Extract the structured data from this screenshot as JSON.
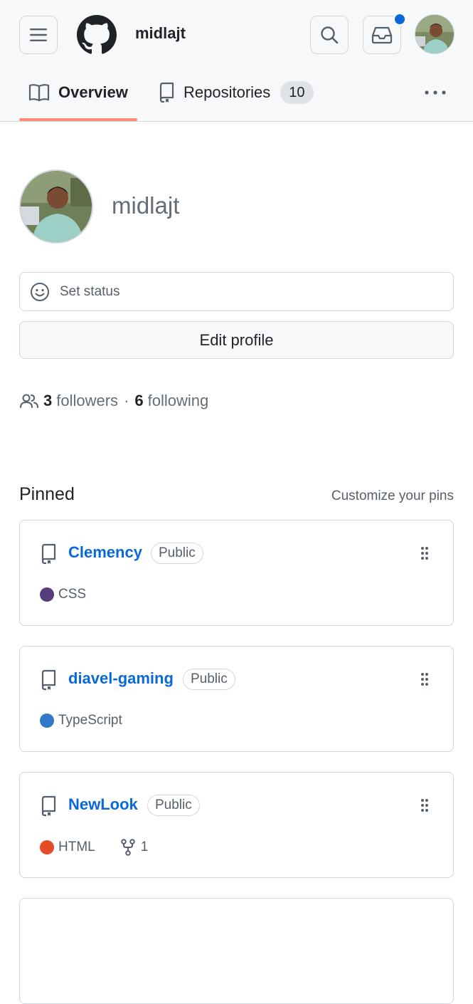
{
  "header": {
    "username": "midlajt"
  },
  "tabs": [
    {
      "label": "Overview",
      "icon": "book-icon"
    },
    {
      "label": "Repositories",
      "icon": "repo-icon",
      "count": "10"
    }
  ],
  "profile": {
    "name": "midlajt",
    "status_placeholder": "Set status",
    "edit_label": "Edit profile",
    "followers_count": "3",
    "followers_label": "followers",
    "separator": "·",
    "following_count": "6",
    "following_label": "following"
  },
  "pinned": {
    "title": "Pinned",
    "customize_label": "Customize your pins",
    "repos": [
      {
        "name": "Clemency",
        "visibility": "Public",
        "language": "CSS",
        "lang_color": "#563d7c"
      },
      {
        "name": "diavel-gaming",
        "visibility": "Public",
        "language": "TypeScript",
        "lang_color": "#3178c6"
      },
      {
        "name": "NewLook",
        "visibility": "Public",
        "language": "HTML",
        "lang_color": "#e34c26",
        "forks": "1"
      }
    ]
  },
  "colors": {
    "accent_link": "#0969da",
    "tab_underline": "#fd8c73",
    "notification_dot": "#0969da"
  }
}
